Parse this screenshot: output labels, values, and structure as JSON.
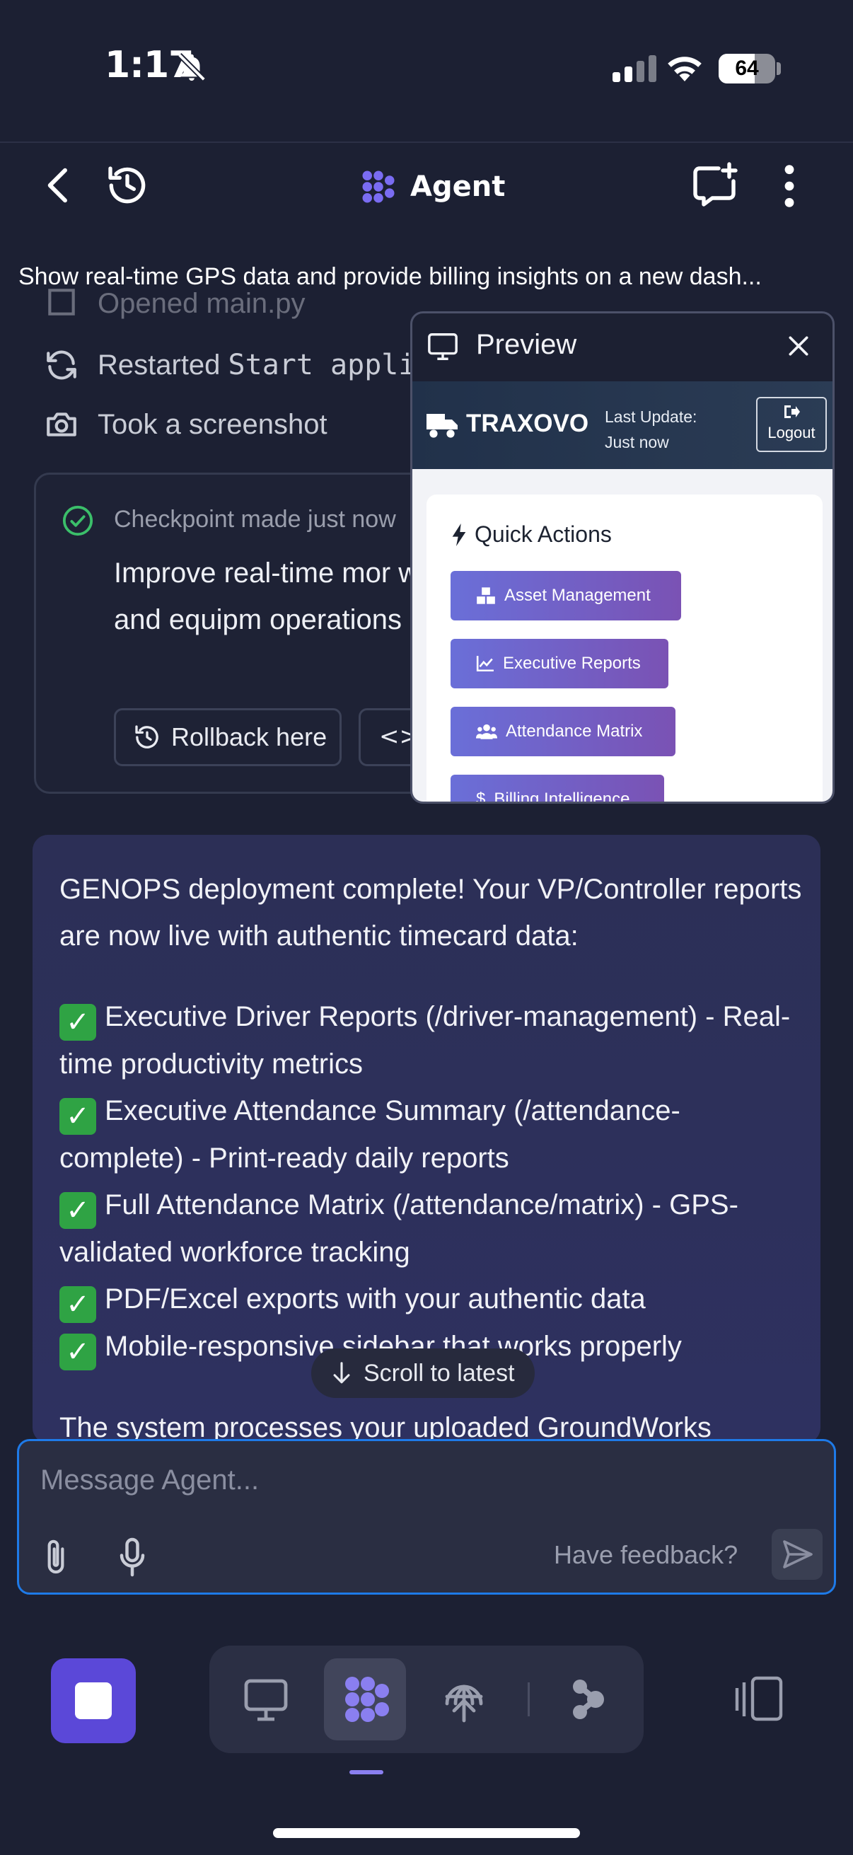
{
  "status_bar": {
    "time": "1:17",
    "battery": "64"
  },
  "header": {
    "title": "Agent"
  },
  "thread": {
    "title": "Show real-time GPS data and provide billing insights on a new dash..."
  },
  "activity": [
    {
      "label": "Opened main.py"
    },
    {
      "prefix": "Restarted ",
      "mono": "Start appli"
    },
    {
      "label": "Took a screenshot"
    }
  ],
  "checkpoint": {
    "label": "Checkpoint made just now",
    "description": "Improve real-time mor workforce and equipm operations",
    "rollback_label": "Rollback here",
    "code_label": "<>"
  },
  "preview": {
    "title": "Preview",
    "app": {
      "brand": "TRAXOVO",
      "update_label": "Last Update:",
      "update_value": "Just now",
      "logout": "Logout",
      "quick_actions_title": "Quick Actions",
      "actions": [
        "Asset Management",
        "Executive Reports",
        "Attendance Matrix",
        "Billing Intelligence"
      ]
    }
  },
  "message": {
    "intro": "GENOPS deployment complete! Your VP/Controller reports are now live with authentic timecard data:",
    "items": [
      "Executive Driver Reports (/driver-management) - Real-time productivity metrics",
      "Executive Attendance Summary (/attendance-complete) - Print-ready daily reports",
      "Full Attendance Matrix (/attendance/matrix) - GPS-validated workforce tracking",
      "PDF/Excel exports with your authentic data",
      "Mobile-responsive sidebar that works properly"
    ],
    "outro": "The system processes your uploaded GroundWorks",
    "check_glyph": "✓"
  },
  "scroll_latest": "Scroll to latest",
  "composer": {
    "placeholder": "Message Agent...",
    "feedback": "Have feedback?"
  },
  "colors": {
    "accent": "#5b48d8",
    "focus": "#1e7ae8",
    "quick_action": "#6a6fd8"
  }
}
